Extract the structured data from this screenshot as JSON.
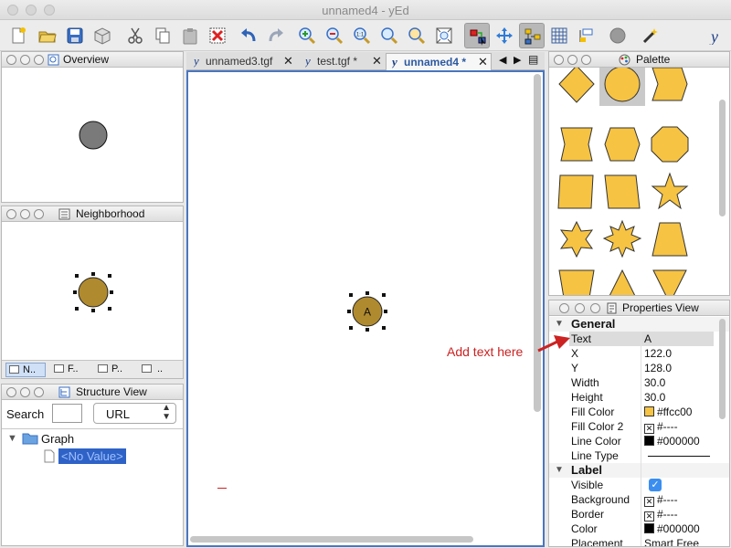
{
  "window": {
    "title": "unnamed4 - yEd"
  },
  "colors": {
    "node_fill": "#b08a2e",
    "shape_fill": "#f6c343",
    "selected_tab": "#2c5aa0",
    "annotation": "#cc2222"
  },
  "panels": {
    "overview": {
      "title": "Overview"
    },
    "neighborhood": {
      "title": "Neighborhood",
      "subtabs": [
        "N..",
        "F..",
        "P..",
        ".."
      ]
    },
    "structure": {
      "title": "Structure View",
      "search_label": "Search",
      "search_value": "",
      "filter_value": "URL",
      "tree_root": "Graph",
      "tree_child": "<No Value>"
    },
    "palette": {
      "title": "Palette"
    },
    "properties": {
      "title": "Properties View"
    }
  },
  "tabs": [
    {
      "label": "unnamed3.tgf"
    },
    {
      "label": "test.tgf *"
    },
    {
      "label": "unnamed4 *"
    }
  ],
  "canvas": {
    "node_label": "A"
  },
  "annotation": {
    "text": "Add text here"
  },
  "properties": {
    "general": {
      "title": "General",
      "rows": [
        {
          "key": "Text",
          "value": "A"
        },
        {
          "key": "X",
          "value": "122.0"
        },
        {
          "key": "Y",
          "value": "128.0"
        },
        {
          "key": "Width",
          "value": "30.0"
        },
        {
          "key": "Height",
          "value": "30.0"
        },
        {
          "key": "Fill Color",
          "value": "#ffcc00"
        },
        {
          "key": "Fill Color 2",
          "value": "#----"
        },
        {
          "key": "Line Color",
          "value": "#000000"
        },
        {
          "key": "Line Type",
          "value": ""
        }
      ]
    },
    "label": {
      "title": "Label",
      "rows": [
        {
          "key": "Visible",
          "value": ""
        },
        {
          "key": "Background",
          "value": "#----"
        },
        {
          "key": "Border",
          "value": "#----"
        },
        {
          "key": "Color",
          "value": "#000000"
        },
        {
          "key": "Placement",
          "value": "Smart Free"
        }
      ]
    }
  }
}
